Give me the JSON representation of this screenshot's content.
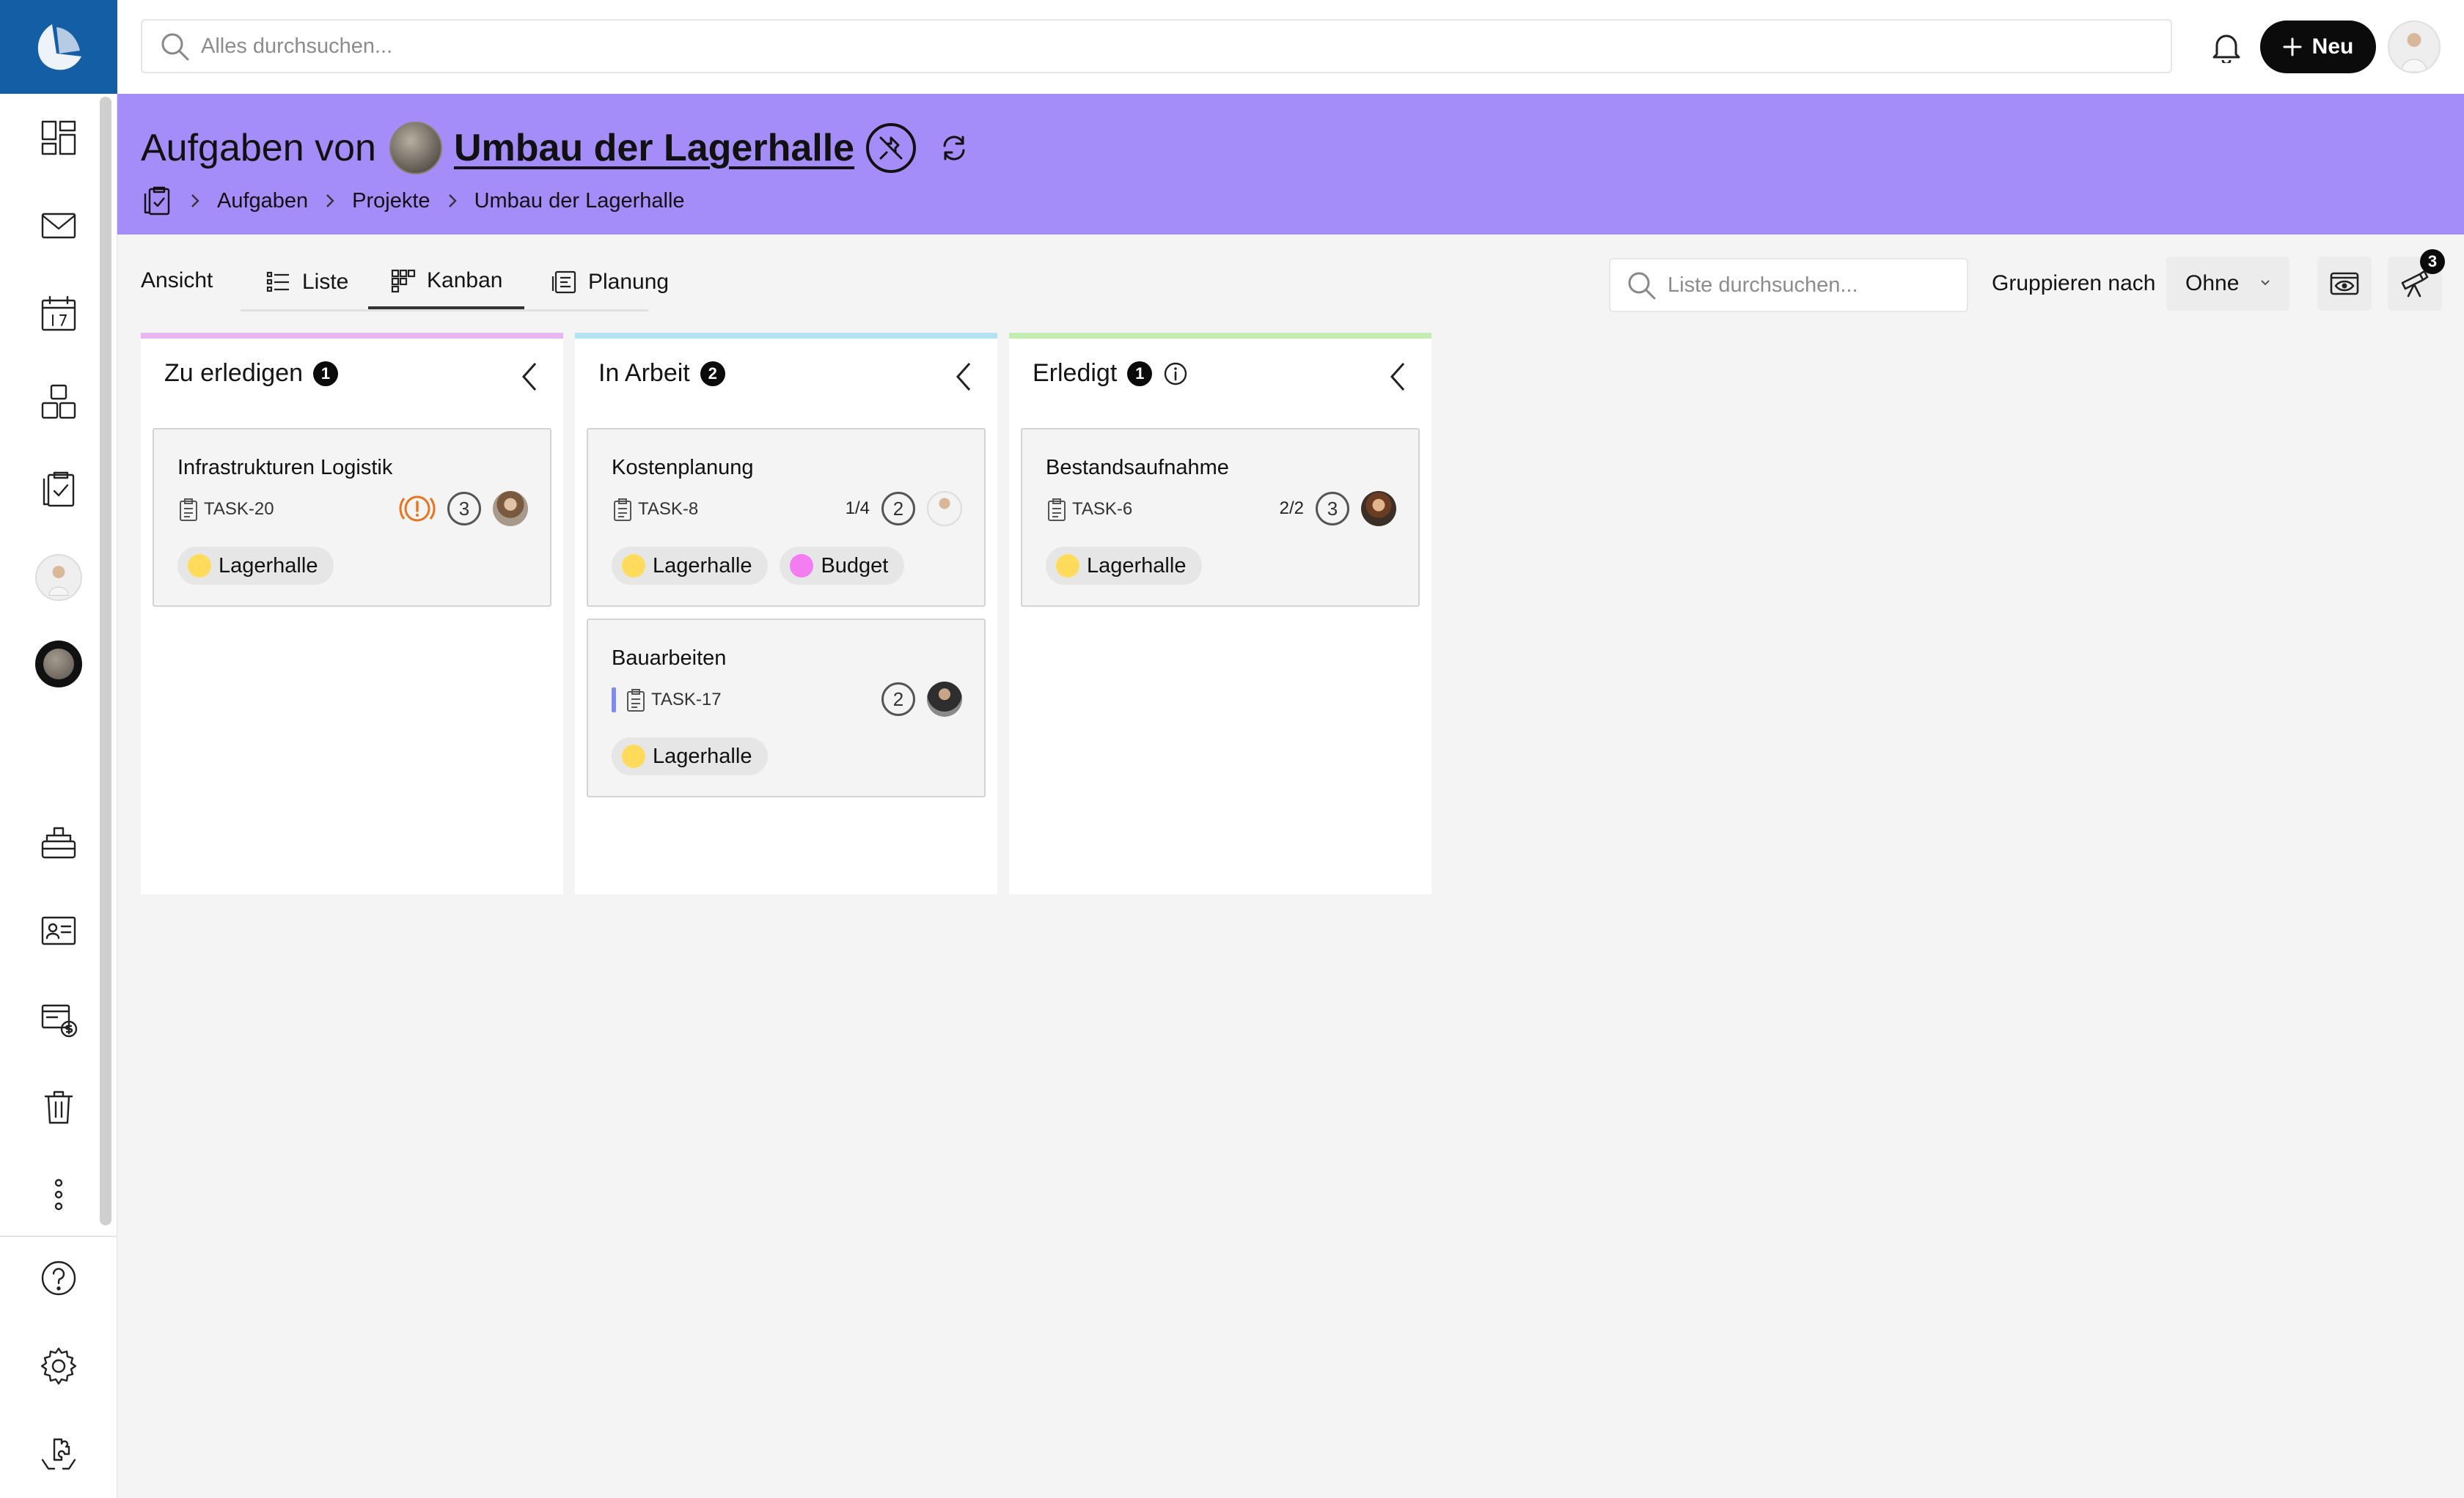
{
  "topbar": {
    "search_placeholder": "Alles durchsuchen...",
    "new_label": "Neu"
  },
  "header": {
    "title_prefix": "Aufgaben von",
    "project_name": "Umbau der Lagerhalle",
    "breadcrumb": [
      "Aufgaben",
      "Projekte",
      "Umbau der Lagerhalle"
    ],
    "background_color": "#a58df9"
  },
  "toolbar": {
    "view_label": "Ansicht",
    "tabs": [
      {
        "label": "Liste",
        "icon": "list-icon"
      },
      {
        "label": "Kanban",
        "icon": "kanban-icon",
        "active": true
      },
      {
        "label": "Planung",
        "icon": "planning-icon"
      }
    ],
    "list_search_placeholder": "Liste durchsuchen...",
    "group_label": "Gruppieren nach",
    "group_value": "Ohne",
    "filter_count": "3"
  },
  "columns": [
    {
      "title": "Zu erledigen",
      "count": "1",
      "color": "#e7b6f3",
      "cards": [
        {
          "title": "Infrastrukturen Logistik",
          "id": "TASK-20",
          "progress": "",
          "comments": "3",
          "overdue": true,
          "tags": [
            {
              "label": "Lagerhalle",
              "color": "#ffdb5c"
            }
          ]
        }
      ]
    },
    {
      "title": "In Arbeit",
      "count": "2",
      "color": "#b5e3f3",
      "cards": [
        {
          "title": "Kostenplanung",
          "id": "TASK-8",
          "progress": "1/4",
          "comments": "2",
          "tags": [
            {
              "label": "Lagerhalle",
              "color": "#ffdb5c"
            },
            {
              "label": "Budget",
              "color": "#f37df0"
            }
          ]
        },
        {
          "title": "Bauarbeiten",
          "id": "TASK-17",
          "progress": "",
          "comments": "2",
          "tags": [
            {
              "label": "Lagerhalle",
              "color": "#ffdb5c"
            }
          ]
        }
      ]
    },
    {
      "title": "Erledigt",
      "count": "1",
      "color": "#c5ecb2",
      "cards": [
        {
          "title": "Bestandsaufnahme",
          "id": "TASK-6",
          "progress": "2/2",
          "comments": "3",
          "tags": [
            {
              "label": "Lagerhalle",
              "color": "#ffdb5c"
            }
          ]
        }
      ]
    }
  ],
  "colors": {
    "brand": "#145ea5",
    "accent": "#a58df9",
    "overdue": "#e8741f"
  }
}
